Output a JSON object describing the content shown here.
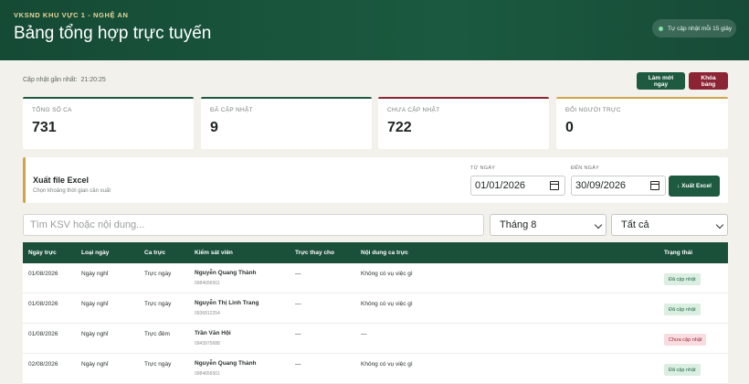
{
  "header": {
    "org": "VKSND KHU VỰC 1 - NGHỆ AN",
    "title": "Bảng tổng hợp trực tuyến",
    "auto_refresh": "Tự cập nhật mỗi 15 giây"
  },
  "toolbar": {
    "updated_label": "Cập nhật gần nhất:",
    "updated_time": "21:20:25",
    "refresh_label": "Làm mới ngay",
    "lock_label": "Khóa bảng"
  },
  "stats": [
    {
      "label": "TỔNG SỐ CA",
      "value": "731",
      "color": "#1d5a40"
    },
    {
      "label": "ĐÃ CẬP NHẬT",
      "value": "9",
      "color": "#1d5a40"
    },
    {
      "label": "CHƯA CẬP NHẬT",
      "value": "722",
      "color": "#8b2434"
    },
    {
      "label": "ĐỔI NGƯỜI TRỰC",
      "value": "0",
      "color": "#d2a44a"
    }
  ],
  "export": {
    "title": "Xuất file Excel",
    "subtitle": "Chọn khoảng thời gian cần xuất",
    "from_label": "TỪ NGÀY",
    "from_value": "01/01/2026",
    "to_label": "ĐẾN NGÀY",
    "to_value": "30/09/2026",
    "button_label": "↓ Xuất Excel"
  },
  "filters": {
    "search_placeholder": "Tìm KSV hoặc nội dung...",
    "month_value": "Tháng 8",
    "status_value": "Tất cả"
  },
  "table": {
    "headers": [
      "Ngày trực",
      "Loại ngày",
      "Ca trực",
      "Kiểm sát viên",
      "Trực thay cho",
      "Nội dung ca trực",
      "Trạng thái"
    ],
    "rows": [
      {
        "date": "01/08/2026",
        "day_type": "Ngày nghỉ",
        "shift": "Trực ngày",
        "name": "Nguyễn Quang Thành",
        "phone": "0984656561",
        "substitute": "—",
        "content": "Không có vụ việc gì",
        "status": "Đã cập nhật",
        "status_kind": "ok"
      },
      {
        "date": "01/08/2026",
        "day_type": "Ngày nghỉ",
        "shift": "Trực ngày",
        "name": "Nguyễn Thị Linh Trang",
        "phone": "0936812254",
        "substitute": "—",
        "content": "Không có vụ việc gì",
        "status": "Đã cập nhật",
        "status_kind": "ok"
      },
      {
        "date": "01/08/2026",
        "day_type": "Ngày nghỉ",
        "shift": "Trực đêm",
        "name": "Trần Văn Hội",
        "phone": "0943975688",
        "substitute": "—",
        "content": "—",
        "status": "Chưa cập nhật",
        "status_kind": "pending"
      },
      {
        "date": "02/08/2026",
        "day_type": "Ngày nghỉ",
        "shift": "Trực ngày",
        "name": "Nguyễn Quang Thành",
        "phone": "0984656561",
        "substitute": "—",
        "content": "Không có vụ việc gì",
        "status": "Đã cập nhật",
        "status_kind": "ok"
      }
    ]
  }
}
